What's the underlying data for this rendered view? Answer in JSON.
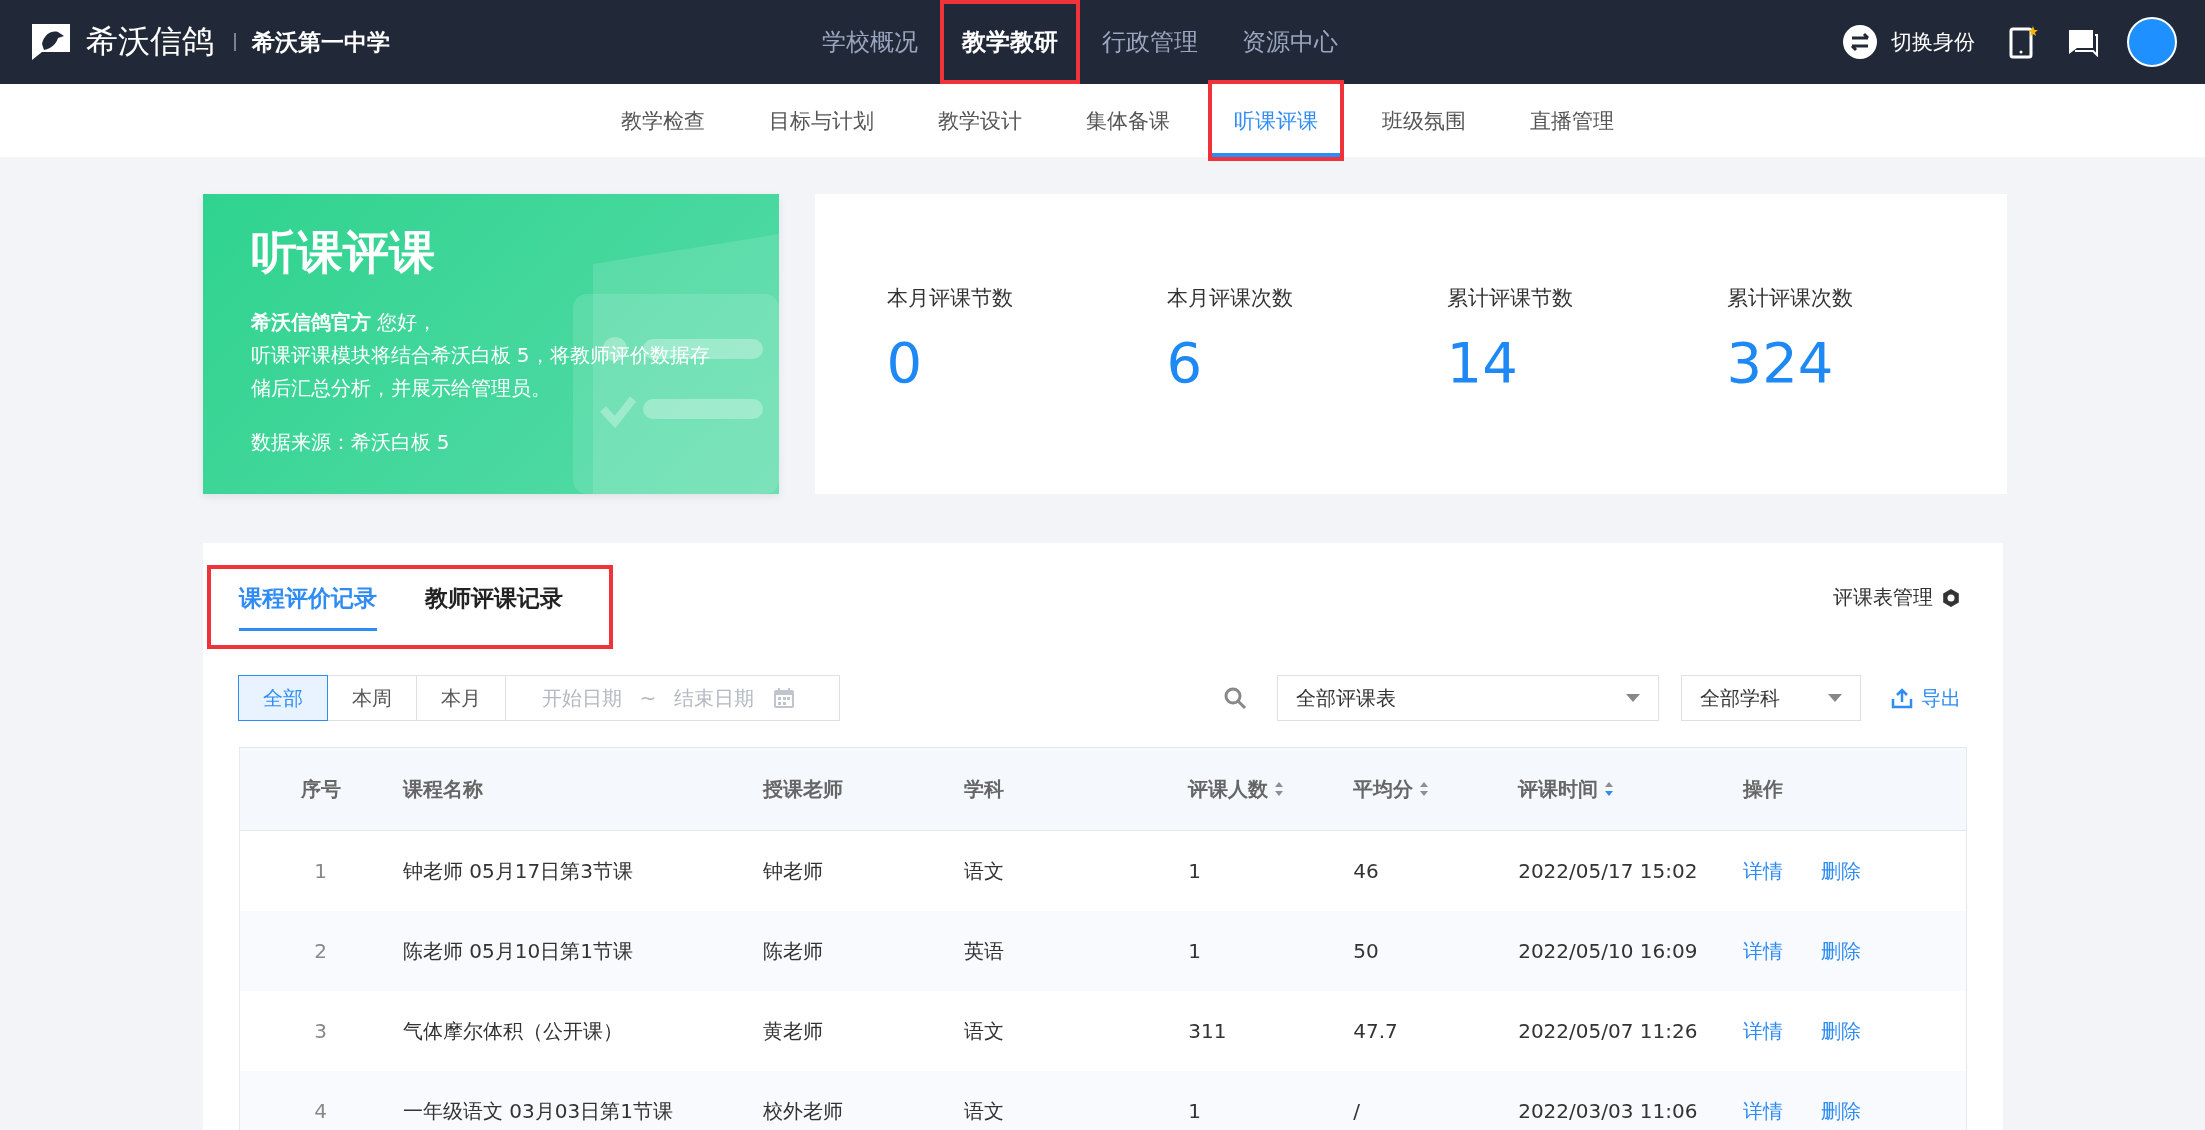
{
  "top_bar": {
    "brand": "希沃信鸽",
    "school": "希沃第一中学",
    "nav": [
      {
        "label": "学校概况",
        "selected": false,
        "highlighted": false
      },
      {
        "label": "教学教研",
        "selected": true,
        "highlighted": true
      },
      {
        "label": "行政管理",
        "selected": false,
        "highlighted": false
      },
      {
        "label": "资源中心",
        "selected": false,
        "highlighted": false
      }
    ],
    "switch_identity": "切换身份"
  },
  "sub_nav": [
    {
      "label": "教学检查",
      "selected": false,
      "highlighted": false
    },
    {
      "label": "目标与计划",
      "selected": false,
      "highlighted": false
    },
    {
      "label": "教学设计",
      "selected": false,
      "highlighted": false
    },
    {
      "label": "集体备课",
      "selected": false,
      "highlighted": false
    },
    {
      "label": "听课评课",
      "selected": true,
      "highlighted": true
    },
    {
      "label": "班级氛围",
      "selected": false,
      "highlighted": false
    },
    {
      "label": "直播管理",
      "selected": false,
      "highlighted": false
    }
  ],
  "banner": {
    "title": "听课评课",
    "greeting": "**希沃信鸽官方** 您好，",
    "description": "听课评课模块将结合希沃白板 5，将教师评价数据存储后汇总分析，并展示给管理员。",
    "source": "数据来源：希沃白板 5"
  },
  "stats": [
    {
      "label": "本月评课节数",
      "value": "0"
    },
    {
      "label": "本月评课次数",
      "value": "6"
    },
    {
      "label": "累计评课节数",
      "value": "14"
    },
    {
      "label": "累计评课次数",
      "value": "324"
    }
  ],
  "records": {
    "tabs_highlighted": true,
    "tabs": [
      {
        "label": "课程评价记录",
        "selected": true
      },
      {
        "label": "教师评课记录",
        "selected": false
      }
    ],
    "manage_link": "评课表管理",
    "periods": [
      {
        "label": "全部",
        "selected": true
      },
      {
        "label": "本周",
        "selected": false
      },
      {
        "label": "本月",
        "selected": false
      }
    ],
    "date_range": {
      "start_placeholder": "开始日期",
      "separator": "~",
      "end_placeholder": "结束日期"
    },
    "form_filter": "全部评课表",
    "subject_filter": "全部学科",
    "export": "导出",
    "table": {
      "columns": [
        {
          "label": "序号",
          "sortable": false
        },
        {
          "label": "课程名称",
          "sortable": false
        },
        {
          "label": "授课老师",
          "sortable": false
        },
        {
          "label": "学科",
          "sortable": false
        },
        {
          "label": "评课人数",
          "sortable": true,
          "sorted_desc": false
        },
        {
          "label": "平均分",
          "sortable": true,
          "sorted_desc": false
        },
        {
          "label": "评课时间",
          "sortable": true,
          "sorted_desc": true
        },
        {
          "label": "操作",
          "sortable": false
        }
      ],
      "rows": [
        {
          "index": "1",
          "course": "钟老师 05月17日第3节课",
          "teacher": "钟老师",
          "subject": "语文",
          "reviewers": "1",
          "average": "46",
          "time": "2022/05/17 15:02",
          "actions": [
            "详情",
            "删除"
          ]
        },
        {
          "index": "2",
          "course": "陈老师 05月10日第1节课",
          "teacher": "陈老师",
          "subject": "英语",
          "reviewers": "1",
          "average": "50",
          "time": "2022/05/10 16:09",
          "actions": [
            "详情",
            "删除"
          ]
        },
        {
          "index": "3",
          "course": "气体摩尔体积（公开课）",
          "teacher": "黄老师",
          "subject": "语文",
          "reviewers": "311",
          "average": "47.7",
          "time": "2022/05/07 11:26",
          "actions": [
            "详情",
            "删除"
          ]
        },
        {
          "index": "4",
          "course": "一年级语文 03月03日第1节课",
          "teacher": "校外老师",
          "subject": "语文",
          "reviewers": "1",
          "average": "/",
          "time": "2022/03/03 11:06",
          "actions": [
            "详情",
            "删除"
          ]
        }
      ]
    }
  }
}
